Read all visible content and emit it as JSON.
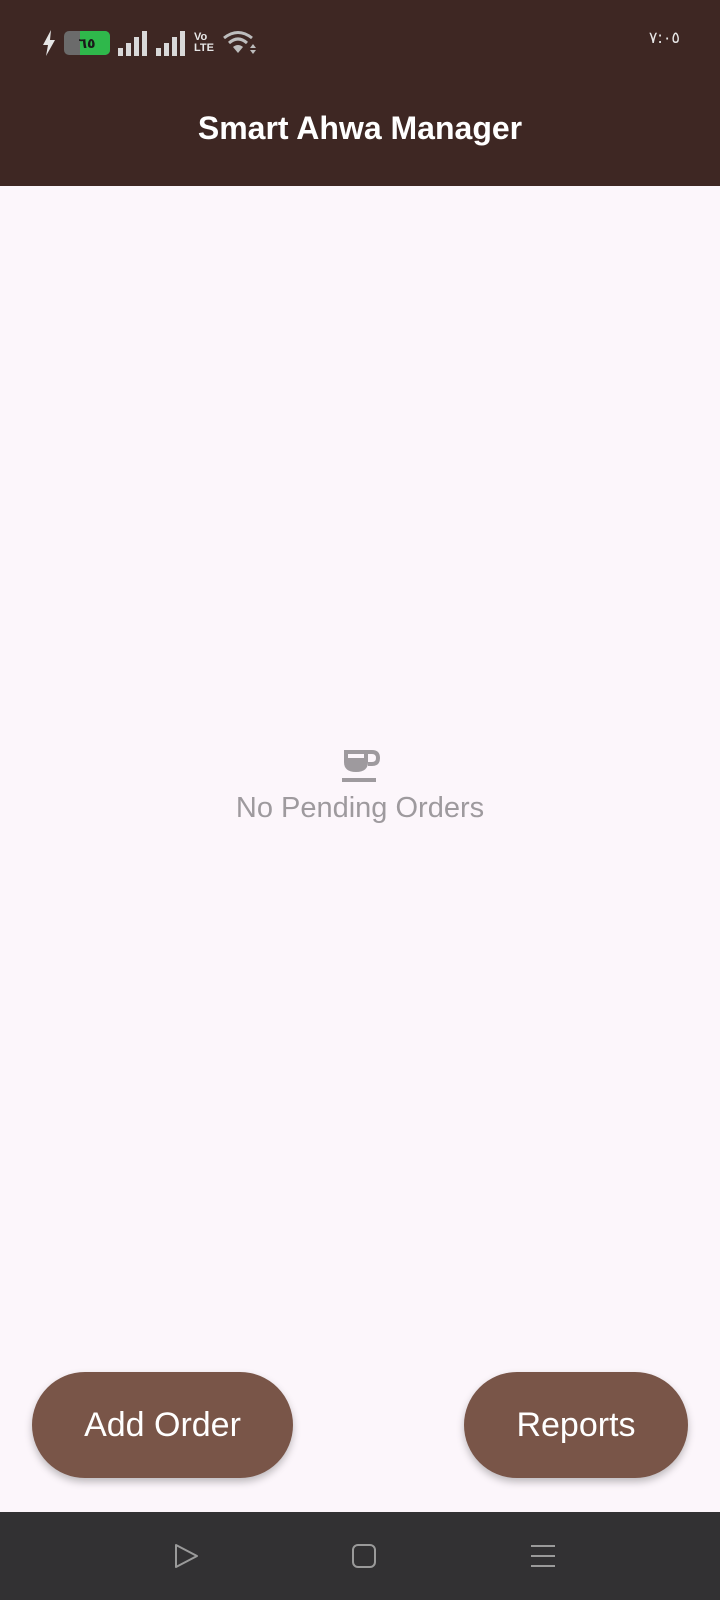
{
  "status_bar": {
    "battery_level": "٦٥",
    "battery_fraction": 0.65,
    "volte_label_top": "Vo",
    "volte_label_bottom": "LTE",
    "clock": "٧:٠٥",
    "icons": [
      "charging-icon",
      "battery-icon",
      "signal-icon",
      "signal-icon",
      "volte-icon",
      "wifi-icon"
    ],
    "colors": {
      "background": "#3e2723",
      "battery_fill": "#2fb84b"
    }
  },
  "app_bar": {
    "title": "Smart Ahwa Manager",
    "background": "#3e2723"
  },
  "empty_state": {
    "icon": "coffee-cup-icon",
    "message": "No Pending Orders"
  },
  "actions": {
    "add_order_label": "Add Order",
    "reports_label": "Reports",
    "button_color": "#795548"
  },
  "nav_bar": {
    "icons": [
      "back-icon",
      "home-icon",
      "recents-icon"
    ]
  }
}
